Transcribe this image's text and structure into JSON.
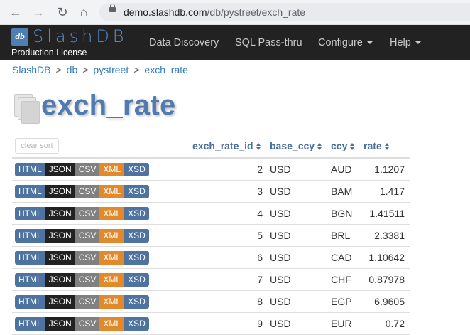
{
  "browser": {
    "url_host": "demo.slashdb.com",
    "url_path": "/db/pystreet/exch_rate"
  },
  "navbar": {
    "brand_glyph": "db",
    "brand_name": "SlashDB",
    "license": "Production License",
    "links": [
      "Data Discovery",
      "SQL Pass-thru",
      "Configure",
      "Help"
    ]
  },
  "breadcrumb": [
    "SlashDB",
    "db",
    "pystreet",
    "exch_rate"
  ],
  "breadcrumb_separator": ">",
  "page_title": "exch_rate",
  "table": {
    "clear_sort_label": "clear sort",
    "headers": [
      "exch_rate_id",
      "base_ccy",
      "ccy",
      "rate"
    ],
    "format_labels": [
      "HTML",
      "JSON",
      "CSV",
      "XML",
      "XSD"
    ],
    "rows": [
      {
        "id": "2",
        "base": "USD",
        "ccy": "AUD",
        "rate": "1.1207"
      },
      {
        "id": "3",
        "base": "USD",
        "ccy": "BAM",
        "rate": "1.417"
      },
      {
        "id": "4",
        "base": "USD",
        "ccy": "BGN",
        "rate": "1.41511"
      },
      {
        "id": "5",
        "base": "USD",
        "ccy": "BRL",
        "rate": "2.3381"
      },
      {
        "id": "6",
        "base": "USD",
        "ccy": "CAD",
        "rate": "1.10642"
      },
      {
        "id": "7",
        "base": "USD",
        "ccy": "CHF",
        "rate": "0.87978"
      },
      {
        "id": "8",
        "base": "USD",
        "ccy": "EGP",
        "rate": "6.9605"
      },
      {
        "id": "9",
        "base": "USD",
        "ccy": "EUR",
        "rate": "0.72"
      }
    ]
  },
  "colors": {
    "navbar_bg": "#222222",
    "brand_blue": "#4f7bb0",
    "format_html": "#4f73a0",
    "format_json": "#222222",
    "format_csv": "#808080",
    "format_xml": "#e08a2d",
    "format_xsd": "#4f73a0"
  }
}
